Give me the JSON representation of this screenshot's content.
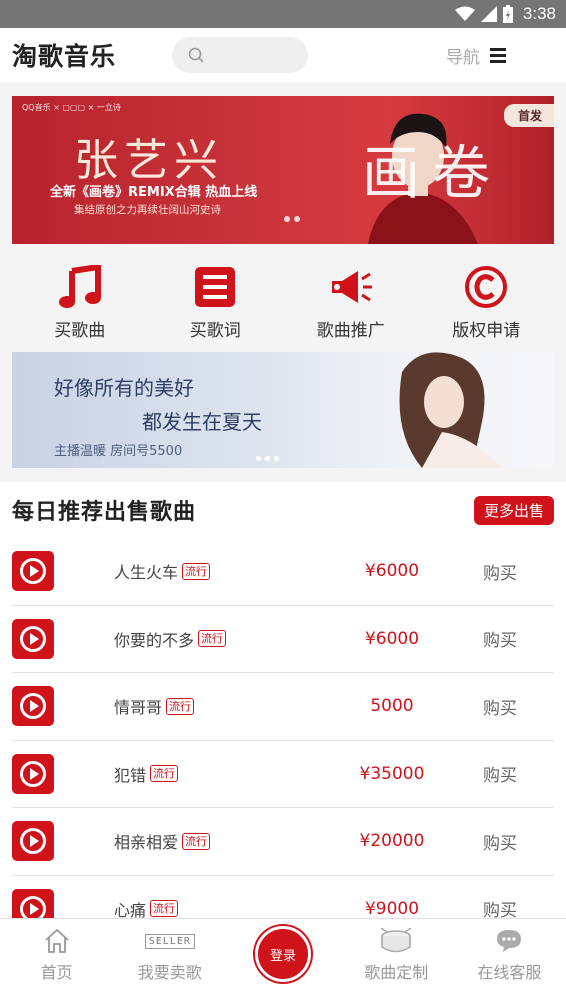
{
  "status_bar": {
    "time": "3:38"
  },
  "header": {
    "title": "淘歌音乐",
    "search_placeholder": "",
    "nav_label": "导航"
  },
  "banner": {
    "logos": "QQ音乐 × ▢▢▢ × 一立诗",
    "badge": "首发",
    "headline": "张艺兴",
    "calligraphy": "画卷",
    "line1": "全新《画卷》REMIX合辑 热血上线",
    "line2": "集结原创之力再续壮阔山河史诗"
  },
  "quick_links": [
    {
      "label": "买歌曲",
      "icon": "music-note-icon"
    },
    {
      "label": "买歌词",
      "icon": "lyrics-list-icon"
    },
    {
      "label": "歌曲推广",
      "icon": "megaphone-icon"
    },
    {
      "label": "版权申请",
      "icon": "copyright-icon"
    }
  ],
  "banner2": {
    "line1": "好像所有的美好",
    "line2": "都发生在夏天",
    "line3": "主播温暖  房间号5500"
  },
  "section": {
    "title": "每日推荐出售歌曲",
    "more_label": "更多出售"
  },
  "songs": [
    {
      "name": "人生火车",
      "tag": "流行",
      "price": "¥6000",
      "buy": "购买"
    },
    {
      "name": "你要的不多",
      "tag": "流行",
      "price": "¥6000",
      "buy": "购买"
    },
    {
      "name": "情哥哥",
      "tag": "流行",
      "price": "5000",
      "buy": "购买"
    },
    {
      "name": "犯错",
      "tag": "流行",
      "price": "¥35000",
      "buy": "购买"
    },
    {
      "name": "相亲相爱",
      "tag": "流行",
      "price": "¥20000",
      "buy": "购买"
    },
    {
      "name": "心痛",
      "tag": "流行",
      "price": "¥9000",
      "buy": "购买"
    }
  ],
  "bottom_nav": {
    "home": "首页",
    "sell": "我要卖歌",
    "seller_badge": "SELLER",
    "login": "登录",
    "custom": "歌曲定制",
    "service": "在线客服"
  },
  "colors": {
    "accent": "#d0121b",
    "status_bar": "#757575"
  }
}
